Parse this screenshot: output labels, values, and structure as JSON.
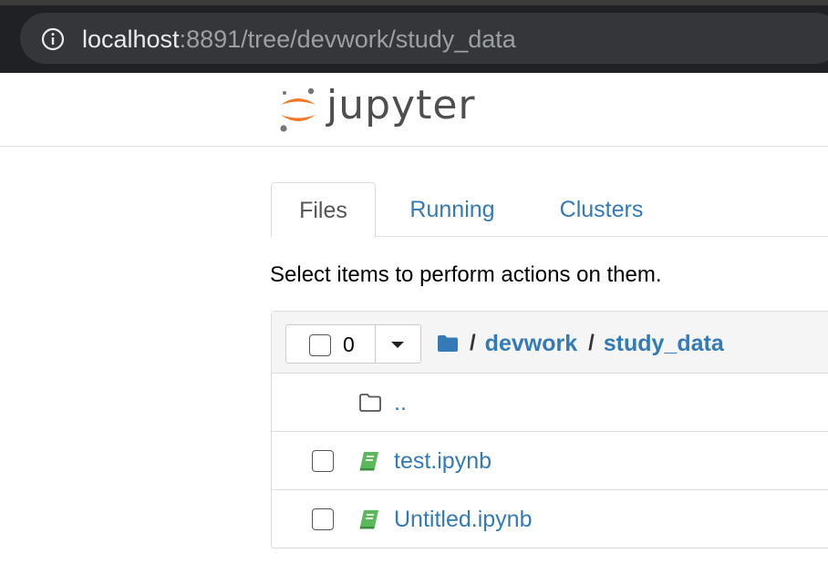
{
  "browser": {
    "url_host": "localhost",
    "url_path": ":8891/tree/devwork/study_data",
    "info_icon": "info-circle-icon"
  },
  "header": {
    "logo_text": "jupyter",
    "logo_icon": "jupyter-logo-icon",
    "logo_colors": {
      "orange": "#f37726",
      "gray": "#767677"
    }
  },
  "tabs": [
    {
      "label": "Files",
      "active": true
    },
    {
      "label": "Running",
      "active": false
    },
    {
      "label": "Clusters",
      "active": false
    }
  ],
  "instructions": "Select items to perform actions on them.",
  "toolbar": {
    "selected_count": "0",
    "dropdown_icon": "caret-down-icon"
  },
  "breadcrumb": {
    "root_icon": "folder-icon",
    "separator": "/",
    "items": [
      "devwork",
      "study_data"
    ]
  },
  "files": [
    {
      "name": "..",
      "type": "parent",
      "icon": "folder-open-icon"
    },
    {
      "name": "test.ipynb",
      "type": "notebook",
      "icon": "notebook-icon"
    },
    {
      "name": "Untitled.ipynb",
      "type": "notebook",
      "icon": "notebook-icon"
    }
  ],
  "colors": {
    "link": "#337ab7",
    "notebook_icon": "#5cb85c",
    "chrome_bg": "#202124"
  }
}
